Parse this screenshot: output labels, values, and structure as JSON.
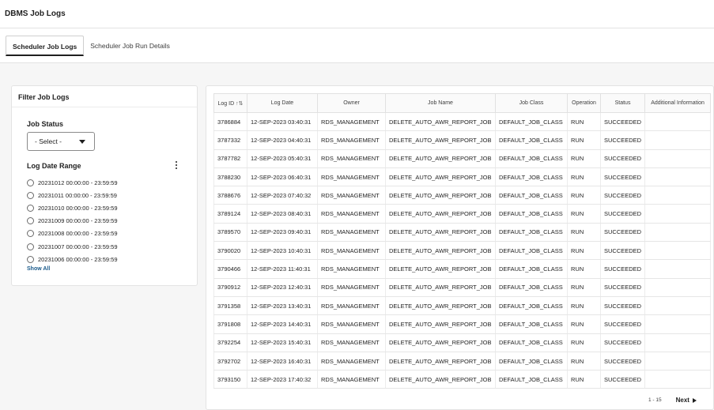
{
  "app": {
    "title": "DBMS Job Logs"
  },
  "tabs": [
    {
      "label": "Scheduler Job Logs",
      "active": true
    },
    {
      "label": "Scheduler Job Run Details",
      "active": false
    }
  ],
  "filter": {
    "title": "Filter Job Logs",
    "job_status_label": "Job Status",
    "job_status_value": "- Select -",
    "date_range_label": "Log Date Range",
    "date_ranges": [
      "20231012 00:00:00 - 23:59:59",
      "20231011 00:00:00 - 23:59:59",
      "20231010 00:00:00 - 23:59:59",
      "20231009 00:00:00 - 23:59:59",
      "20231008 00:00:00 - 23:59:59",
      "20231007 00:00:00 - 23:59:59",
      "20231006 00:00:00 - 23:59:59"
    ],
    "show_all": "Show All"
  },
  "table": {
    "columns": [
      "Log ID",
      "Log Date",
      "Owner",
      "Job Name",
      "Job Class",
      "Operation",
      "Status",
      "Additional Information"
    ],
    "rows": [
      [
        "3786884",
        "12-SEP-2023 03:40:31",
        "RDS_MANAGEMENT",
        "DELETE_AUTO_AWR_REPORT_JOB",
        "DEFAULT_JOB_CLASS",
        "RUN",
        "SUCCEEDED",
        ""
      ],
      [
        "3787332",
        "12-SEP-2023 04:40:31",
        "RDS_MANAGEMENT",
        "DELETE_AUTO_AWR_REPORT_JOB",
        "DEFAULT_JOB_CLASS",
        "RUN",
        "SUCCEEDED",
        ""
      ],
      [
        "3787782",
        "12-SEP-2023 05:40:31",
        "RDS_MANAGEMENT",
        "DELETE_AUTO_AWR_REPORT_JOB",
        "DEFAULT_JOB_CLASS",
        "RUN",
        "SUCCEEDED",
        ""
      ],
      [
        "3788230",
        "12-SEP-2023 06:40:31",
        "RDS_MANAGEMENT",
        "DELETE_AUTO_AWR_REPORT_JOB",
        "DEFAULT_JOB_CLASS",
        "RUN",
        "SUCCEEDED",
        ""
      ],
      [
        "3788676",
        "12-SEP-2023 07:40:32",
        "RDS_MANAGEMENT",
        "DELETE_AUTO_AWR_REPORT_JOB",
        "DEFAULT_JOB_CLASS",
        "RUN",
        "SUCCEEDED",
        ""
      ],
      [
        "3789124",
        "12-SEP-2023 08:40:31",
        "RDS_MANAGEMENT",
        "DELETE_AUTO_AWR_REPORT_JOB",
        "DEFAULT_JOB_CLASS",
        "RUN",
        "SUCCEEDED",
        ""
      ],
      [
        "3789570",
        "12-SEP-2023 09:40:31",
        "RDS_MANAGEMENT",
        "DELETE_AUTO_AWR_REPORT_JOB",
        "DEFAULT_JOB_CLASS",
        "RUN",
        "SUCCEEDED",
        ""
      ],
      [
        "3790020",
        "12-SEP-2023 10:40:31",
        "RDS_MANAGEMENT",
        "DELETE_AUTO_AWR_REPORT_JOB",
        "DEFAULT_JOB_CLASS",
        "RUN",
        "SUCCEEDED",
        ""
      ],
      [
        "3790466",
        "12-SEP-2023 11:40:31",
        "RDS_MANAGEMENT",
        "DELETE_AUTO_AWR_REPORT_JOB",
        "DEFAULT_JOB_CLASS",
        "RUN",
        "SUCCEEDED",
        ""
      ],
      [
        "3790912",
        "12-SEP-2023 12:40:31",
        "RDS_MANAGEMENT",
        "DELETE_AUTO_AWR_REPORT_JOB",
        "DEFAULT_JOB_CLASS",
        "RUN",
        "SUCCEEDED",
        ""
      ],
      [
        "3791358",
        "12-SEP-2023 13:40:31",
        "RDS_MANAGEMENT",
        "DELETE_AUTO_AWR_REPORT_JOB",
        "DEFAULT_JOB_CLASS",
        "RUN",
        "SUCCEEDED",
        ""
      ],
      [
        "3791808",
        "12-SEP-2023 14:40:31",
        "RDS_MANAGEMENT",
        "DELETE_AUTO_AWR_REPORT_JOB",
        "DEFAULT_JOB_CLASS",
        "RUN",
        "SUCCEEDED",
        ""
      ],
      [
        "3792254",
        "12-SEP-2023 15:40:31",
        "RDS_MANAGEMENT",
        "DELETE_AUTO_AWR_REPORT_JOB",
        "DEFAULT_JOB_CLASS",
        "RUN",
        "SUCCEEDED",
        ""
      ],
      [
        "3792702",
        "12-SEP-2023 16:40:31",
        "RDS_MANAGEMENT",
        "DELETE_AUTO_AWR_REPORT_JOB",
        "DEFAULT_JOB_CLASS",
        "RUN",
        "SUCCEEDED",
        ""
      ],
      [
        "3793150",
        "12-SEP-2023 17:40:32",
        "RDS_MANAGEMENT",
        "DELETE_AUTO_AWR_REPORT_JOB",
        "DEFAULT_JOB_CLASS",
        "RUN",
        "SUCCEEDED",
        ""
      ]
    ]
  },
  "pagination": {
    "range": "1 - 15",
    "next_label": "Next"
  },
  "icons": {
    "sort": "sort-ascending-icon",
    "dropdown": "chevron-down-icon",
    "more": "kebab-menu-icon",
    "next": "chevron-right-icon"
  }
}
